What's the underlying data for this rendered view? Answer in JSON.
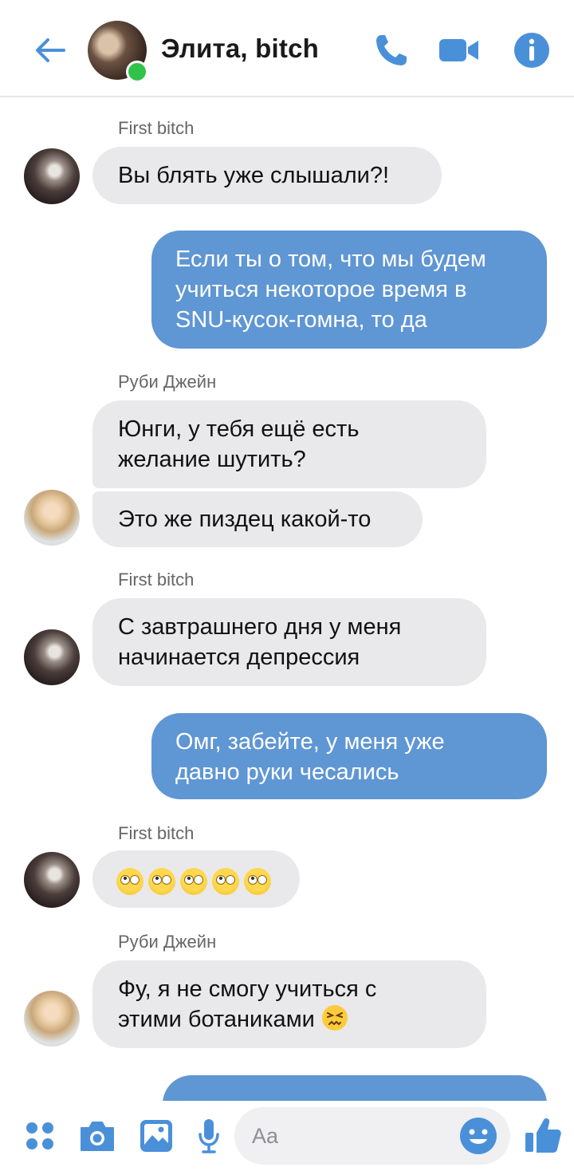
{
  "header": {
    "title": "Элита, bitch",
    "icons": [
      "back-arrow-icon",
      "phone-icon",
      "video-camera-icon",
      "info-icon"
    ],
    "accent_color": "#4a90d9"
  },
  "messages": [
    {
      "sender": "First bitch",
      "text_lines": [
        "Вы блять уже слышали?!"
      ]
    },
    {
      "outgoing": true,
      "text_lines": [
        "Если ты о том, что мы будем",
        "учиться некоторое время в",
        "SNU-кусок-гомна, то да"
      ]
    },
    {
      "sender": "Руби Джейн",
      "text_lines": [
        "Юнги, у тебя ещё есть",
        "желание шутить?"
      ]
    },
    {
      "text_lines": [
        "Это же пиздец какой-то"
      ]
    },
    {
      "sender": "First bitch",
      "text_lines": [
        "С завтрашнего дня у меня",
        "начинается депрессия"
      ]
    },
    {
      "outgoing": true,
      "text_lines": [
        "Омг, забейте, у меня уже",
        "давно руки чесались"
      ]
    },
    {
      "sender": "First bitch",
      "emoji_count": 5,
      "emoji": "face-with-rolling-eyes"
    },
    {
      "sender": "Руби Джейн",
      "text_lines": [
        "Фу, я не смогу учиться с",
        "этими ботаниками"
      ],
      "trailing_emoji": "confounded-face"
    }
  ],
  "composer": {
    "placeholder": "Aa",
    "icons": [
      "apps-icon",
      "camera-icon",
      "gallery-icon",
      "microphone-icon",
      "emoji-icon",
      "thumbs-up-icon"
    ]
  },
  "colors": {
    "incoming_bubble": "#e9e9ec",
    "outgoing_bubble": "#5f96d4",
    "online": "#31c24a"
  }
}
